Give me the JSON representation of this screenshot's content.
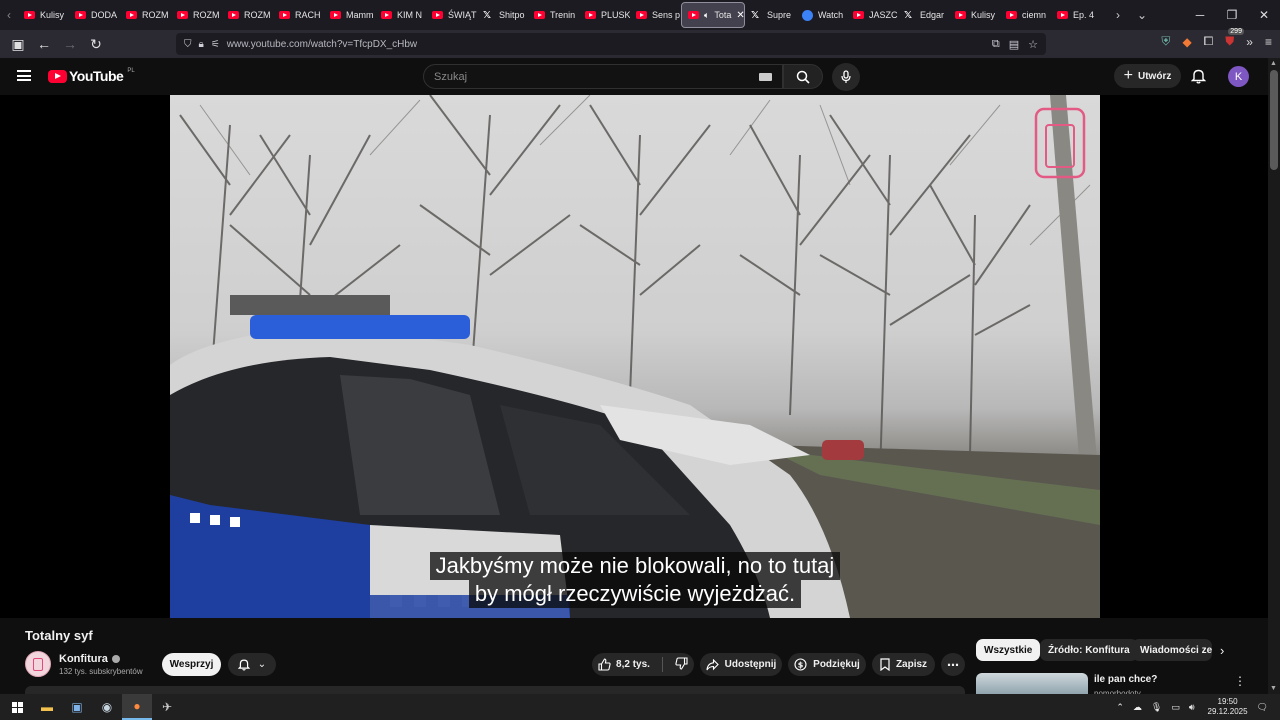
{
  "browser": {
    "tabs": [
      {
        "label": "Kulisy",
        "favicon": "youtube-favicon"
      },
      {
        "label": "DODA",
        "favicon": "youtube-favicon"
      },
      {
        "label": "ROZM",
        "favicon": "youtube-favicon"
      },
      {
        "label": "ROZM",
        "favicon": "youtube-favicon"
      },
      {
        "label": "ROZM",
        "favicon": "youtube-favicon"
      },
      {
        "label": "RACH",
        "favicon": "youtube-favicon"
      },
      {
        "label": "Mamm",
        "favicon": "youtube-favicon"
      },
      {
        "label": "KIM N",
        "favicon": "youtube-favicon"
      },
      {
        "label": "ŚWIĄT",
        "favicon": "youtube-favicon"
      },
      {
        "label": "Shitpo",
        "favicon": "x-favicon"
      },
      {
        "label": "Trenin",
        "favicon": "youtube-favicon"
      },
      {
        "label": "PLUSK",
        "favicon": "youtube-favicon"
      },
      {
        "label": "Sens p",
        "favicon": "youtube-favicon"
      },
      {
        "label": "Tota",
        "favicon": "youtube-favicon",
        "active": true
      },
      {
        "label": "Supre",
        "favicon": "x-favicon"
      },
      {
        "label": "Watch",
        "favicon": "multi-favicon"
      },
      {
        "label": "JASZC",
        "favicon": "youtube-favicon"
      },
      {
        "label": "Edgar",
        "favicon": "x-favicon"
      },
      {
        "label": "Kulisy",
        "favicon": "youtube-favicon"
      },
      {
        "label": "ciemn",
        "favicon": "youtube-favicon"
      },
      {
        "label": "Ep. 4",
        "favicon": "youtube-favicon"
      }
    ],
    "url": "www.youtube.com/watch?v=TfcpDX_cHbw",
    "extension_badge": "299"
  },
  "youtube": {
    "logo_text": "YouTube",
    "region": "PL",
    "search_placeholder": "Szukaj",
    "create_label": "Utwórz",
    "avatar_letter": "K",
    "accent": "#ff0033"
  },
  "video": {
    "subtitle_lines": [
      "Jakbyśmy może nie blokowali, no to tutaj",
      "by mógł rzeczywiście wyjeżdżać."
    ],
    "title": "Totalny syf",
    "channel_name": "Konfitura",
    "channel_subs": "132 tys. subskrybentów",
    "support_label": "Wesprzyj",
    "like_count": "8,2 tys.",
    "share_label": "Udostępnij",
    "thanks_label": "Podziękuj",
    "save_label": "Zapisz"
  },
  "sidebar": {
    "chips": [
      "Wszystkie",
      "Źródło: Konfitura",
      "Wiadomości ze"
    ],
    "recommendation": {
      "title": "ile pan chce?",
      "channel": "pomorbodoty"
    }
  },
  "taskbar": {
    "time": "19:50",
    "date": "29.12.2025"
  }
}
